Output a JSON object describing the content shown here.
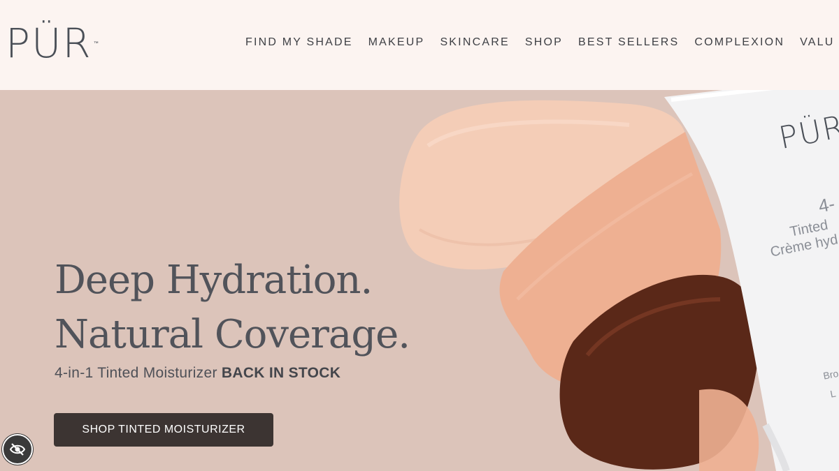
{
  "brand": {
    "logo_text": "PÜR",
    "trademark": "™"
  },
  "nav": {
    "items": [
      {
        "label": "FIND MY SHADE"
      },
      {
        "label": "MAKEUP"
      },
      {
        "label": "SKINCARE"
      },
      {
        "label": "SHOP"
      },
      {
        "label": "BEST SELLERS"
      },
      {
        "label": "COMPLEXION"
      },
      {
        "label": "VALU"
      }
    ]
  },
  "hero": {
    "headline_line1": "Deep Hydration.",
    "headline_line2": "Natural Coverage.",
    "subtitle_prefix": "4-in-1 Tinted Moisturizer ",
    "subtitle_emphasis": "BACK IN STOCK",
    "cta_label": "SHOP TINTED MOISTURIZER",
    "product": {
      "tube_brand": "PÜR",
      "tube_line1": "4-",
      "tube_line2": "Tinted",
      "tube_line3": "Crème hyd",
      "tube_line4": "Bro",
      "tube_line5": "L"
    }
  },
  "accessibility": {
    "icon": "eye-slash-icon"
  },
  "colors": {
    "header_bg": "#fcf4f1",
    "hero_bg": "#dcc4ba",
    "text_dark": "#51535a",
    "cta_bg": "#3c3432",
    "swatch_light": "#f4cdb7",
    "swatch_mid": "#eeb092",
    "swatch_dark": "#5a2818"
  }
}
